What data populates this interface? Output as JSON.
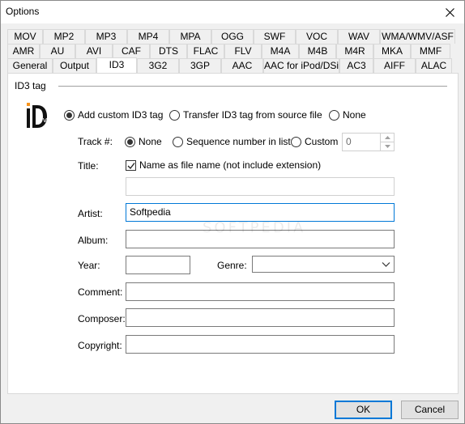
{
  "window": {
    "title": "Options"
  },
  "tabs": {
    "row1": [
      "MOV",
      "MP2",
      "MP3",
      "MP4",
      "MPA",
      "OGG",
      "SWF",
      "VOC",
      "WAV",
      "WMA/WMV/ASF"
    ],
    "row2": [
      "AMR",
      "AU",
      "AVI",
      "CAF",
      "DTS",
      "FLAC",
      "FLV",
      "M4A",
      "M4B",
      "M4R",
      "MKA",
      "MMF"
    ],
    "row3": [
      "General",
      "Output",
      "ID3",
      "3G2",
      "3GP",
      "AAC",
      "AAC for iPod/DSi",
      "AC3",
      "AIFF",
      "ALAC"
    ],
    "active": "ID3"
  },
  "id3": {
    "group_title": "ID3 tag",
    "logo_text": "3v2",
    "mode_options": [
      {
        "label": "Add custom ID3 tag",
        "checked": true
      },
      {
        "label": "Transfer ID3 tag from source file",
        "checked": false
      },
      {
        "label": "None",
        "checked": false
      }
    ],
    "track_label": "Track #:",
    "track_options": [
      {
        "label": "None",
        "checked": true
      },
      {
        "label": "Sequence number in list",
        "checked": false
      },
      {
        "label": "Custom",
        "checked": false
      }
    ],
    "track_custom_value": "0",
    "title_label": "Title:",
    "title_checkbox_label": "Name as file name (not include extension)",
    "title_checkbox_checked": true,
    "title_value": "",
    "artist_label": "Artist:",
    "artist_value": "Softpedia",
    "album_label": "Album:",
    "album_value": "",
    "year_label": "Year:",
    "year_value": "",
    "genre_label": "Genre:",
    "genre_value": "",
    "comment_label": "Comment:",
    "comment_value": "",
    "composer_label": "Composer:",
    "composer_value": "",
    "copyright_label": "Copyright:",
    "copyright_value": ""
  },
  "buttons": {
    "ok": "OK",
    "cancel": "Cancel"
  },
  "watermark": "SOFTPEDIA",
  "colors": {
    "accent": "#0078d7",
    "logo_orange": "#f7941d"
  }
}
